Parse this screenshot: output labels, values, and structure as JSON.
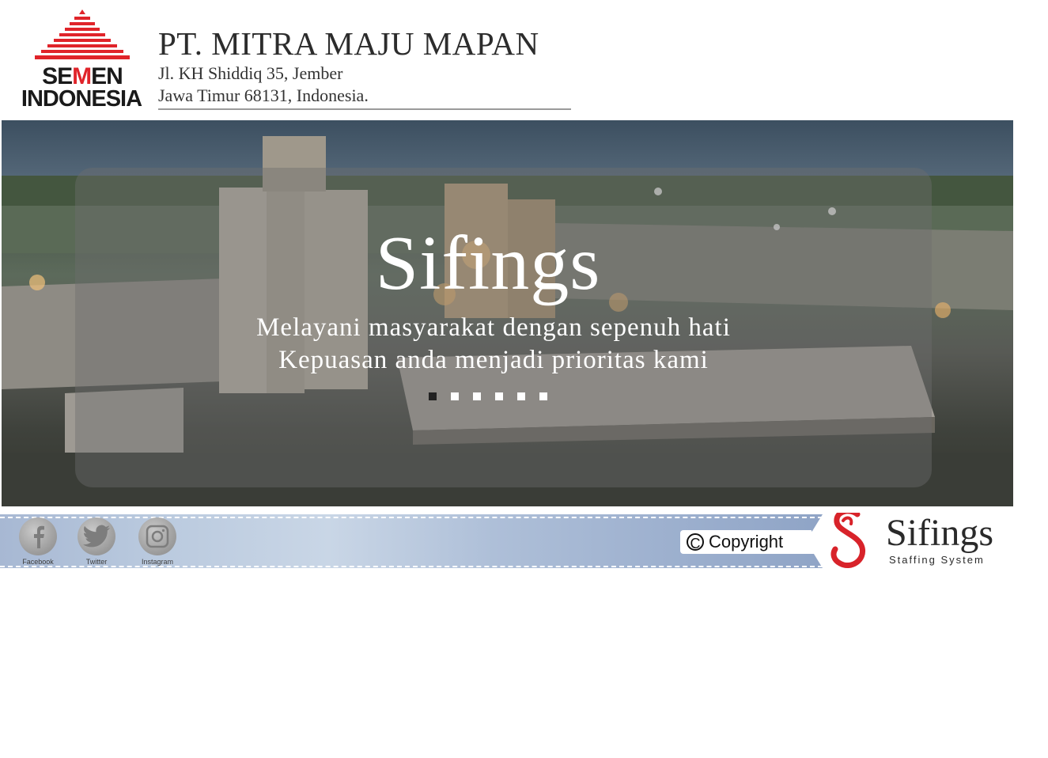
{
  "header": {
    "logo": {
      "word1_prefix": "SE",
      "word1_mark": "M",
      "word1_suffix": "EN",
      "word2": "INDONESIA",
      "tower_icon": "semen-indonesia-tower-icon",
      "red": "#e0242a"
    },
    "company_name": "PT. MITRA MAJU MAPAN",
    "address_line1": "Jl. KH Shiddiq 35, Jember",
    "address_line2": "Jawa Timur 68131, Indonesia."
  },
  "hero": {
    "title": "Sifings",
    "subtitle_line1": "Melayani masyarakat dengan sepenuh hati",
    "subtitle_line2": "Kepuasan anda menjadi prioritas kami",
    "background": "cement-plant-photo",
    "slides": {
      "count": 6,
      "active_index": 0
    }
  },
  "footer": {
    "social": [
      {
        "label": "Facebook",
        "icon": "facebook-icon"
      },
      {
        "label": "Twitter",
        "icon": "twitter-icon"
      },
      {
        "label": "Instagram",
        "icon": "instagram-icon"
      }
    ],
    "copyright_mark": "C",
    "copyright_label": "Copyright",
    "brand_name": "Sifings",
    "brand_tagline": "Staffing System",
    "brand_icon": "sifings-s-logo-icon",
    "brand_red": "#d8232a"
  }
}
